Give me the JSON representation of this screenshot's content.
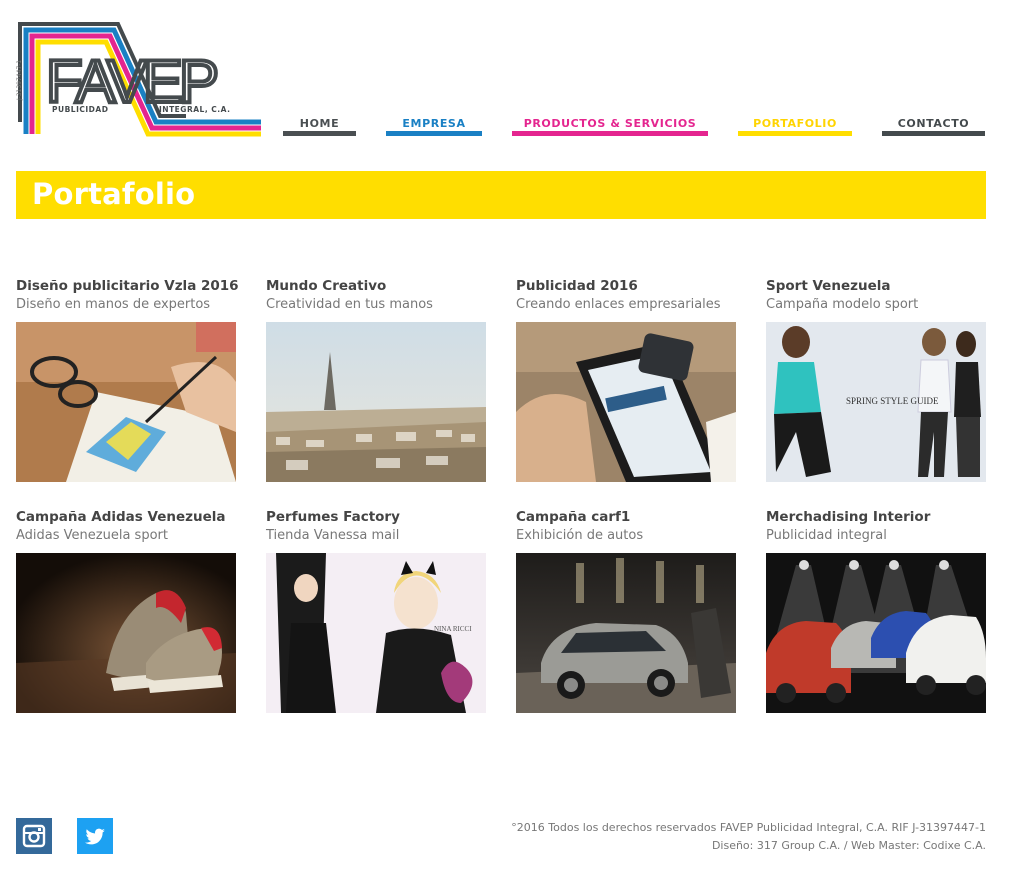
{
  "brand": {
    "logo_letters": "FAVEP",
    "logo_left_text": "PUBLICIDAD",
    "logo_right_text": "INTEGRAL, C.A.",
    "logo_rif": "J-31397447-1",
    "colors": [
      "#1a80c4",
      "#e4258f",
      "#ffde00",
      "#444a4d"
    ]
  },
  "nav": {
    "items": [
      {
        "label": "HOME",
        "color": "#4a4f52",
        "active": false
      },
      {
        "label": "EMPRESA",
        "color": "#1a80c4",
        "active": false
      },
      {
        "label": "PRODUCTOS & SERVICIOS",
        "color": "#e4258f",
        "active": false
      },
      {
        "label": "PORTAFOLIO",
        "color": "#ffde00",
        "active": true
      },
      {
        "label": "CONTACTO",
        "color": "#444a4d",
        "active": false
      }
    ]
  },
  "banner": {
    "title": "Portafolio",
    "color": "#ffde00"
  },
  "portfolio": [
    {
      "title": "Diseño publicitario Vzla 2016",
      "subtitle": "Diseño en manos de expertos",
      "image": "web-design-sketch"
    },
    {
      "title": "Mundo Creativo",
      "subtitle": "Creatividad en tus manos",
      "image": "paris-skyline"
    },
    {
      "title": "Publicidad 2016",
      "subtitle": "Creando enlaces empresariales",
      "image": "tablet-web-design"
    },
    {
      "title": "Sport Venezuela",
      "subtitle": "Campaña modelo sport",
      "image": "sportswear-models"
    },
    {
      "title": "Campaña Adidas Venezuela",
      "subtitle": "Adidas Venezuela sport",
      "image": "adidas-sneakers"
    },
    {
      "title": "Perfumes Factory",
      "subtitle": "Tienda Vanessa mail",
      "image": "perfume-advert"
    },
    {
      "title": "Campaña carf1",
      "subtitle": "Exhibición de autos",
      "image": "car-showroom"
    },
    {
      "title": "Merchadising Interior",
      "subtitle": "Publicidad integral",
      "image": "cars-spotlights"
    }
  ],
  "footer": {
    "copyright": "°2016 Todos los derechos reservados FAVEP Publicidad Integral, C.A. RIF J-31397447-1",
    "credits": "Diseño: 317 Group C.A. / Web Master: Codixe C.A.",
    "social": [
      {
        "name": "instagram-icon",
        "color": "#34699a"
      },
      {
        "name": "twitter-icon",
        "color": "#1da1f2"
      }
    ]
  }
}
